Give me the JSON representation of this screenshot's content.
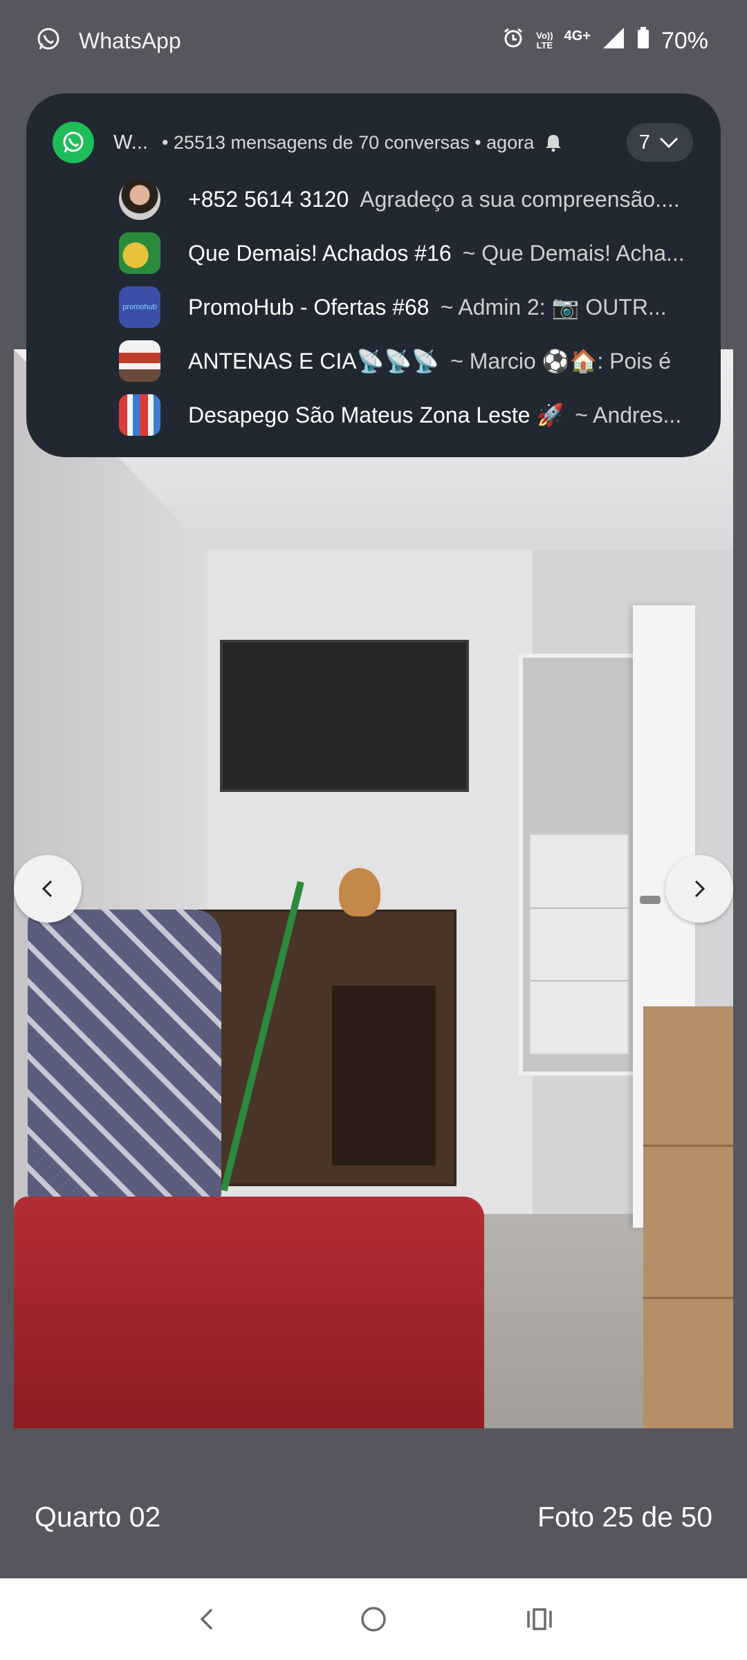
{
  "status_bar": {
    "app_name": "WhatsApp",
    "volte_top": "Vo))",
    "volte_bottom": "LTE",
    "network": "4G+",
    "battery": "70%"
  },
  "notification": {
    "app_short": "W...",
    "meta": "• 25513 mensagens de 70 conversas • agora",
    "count": "7",
    "messages": [
      {
        "name": "+852 5614 3120",
        "body": "Agradeço a sua compreensão...."
      },
      {
        "name": "Que Demais! Achados #16",
        "body": "~ Que Demais! Acha..."
      },
      {
        "name": "PromoHub - Ofertas #68",
        "body": "~ Admin 2: 📷 OUTR..."
      },
      {
        "name": "ANTENAS E CIA📡📡📡",
        "body": "~ Marcio ⚽🏠: Pois é"
      },
      {
        "name": "Desapego São Mateus Zona Leste 🚀",
        "body": "~ Andres..."
      }
    ],
    "promohub_logo_text": "promohub"
  },
  "viewer": {
    "room_label": "Quarto 02",
    "photo_counter": "Foto 25 de 50"
  },
  "colors": {
    "background": "#56565f",
    "notification_bg": "#222831",
    "whatsapp_green": "#1fbd59"
  },
  "icons": {
    "status_app": "whatsapp-icon",
    "alarm": "alarm-icon",
    "signal": "signal-icon",
    "battery": "battery-icon",
    "prev": "chevron-left-icon",
    "next": "chevron-right-icon",
    "sys_back": "back-icon",
    "sys_home": "home-icon",
    "sys_recents": "recents-icon"
  }
}
